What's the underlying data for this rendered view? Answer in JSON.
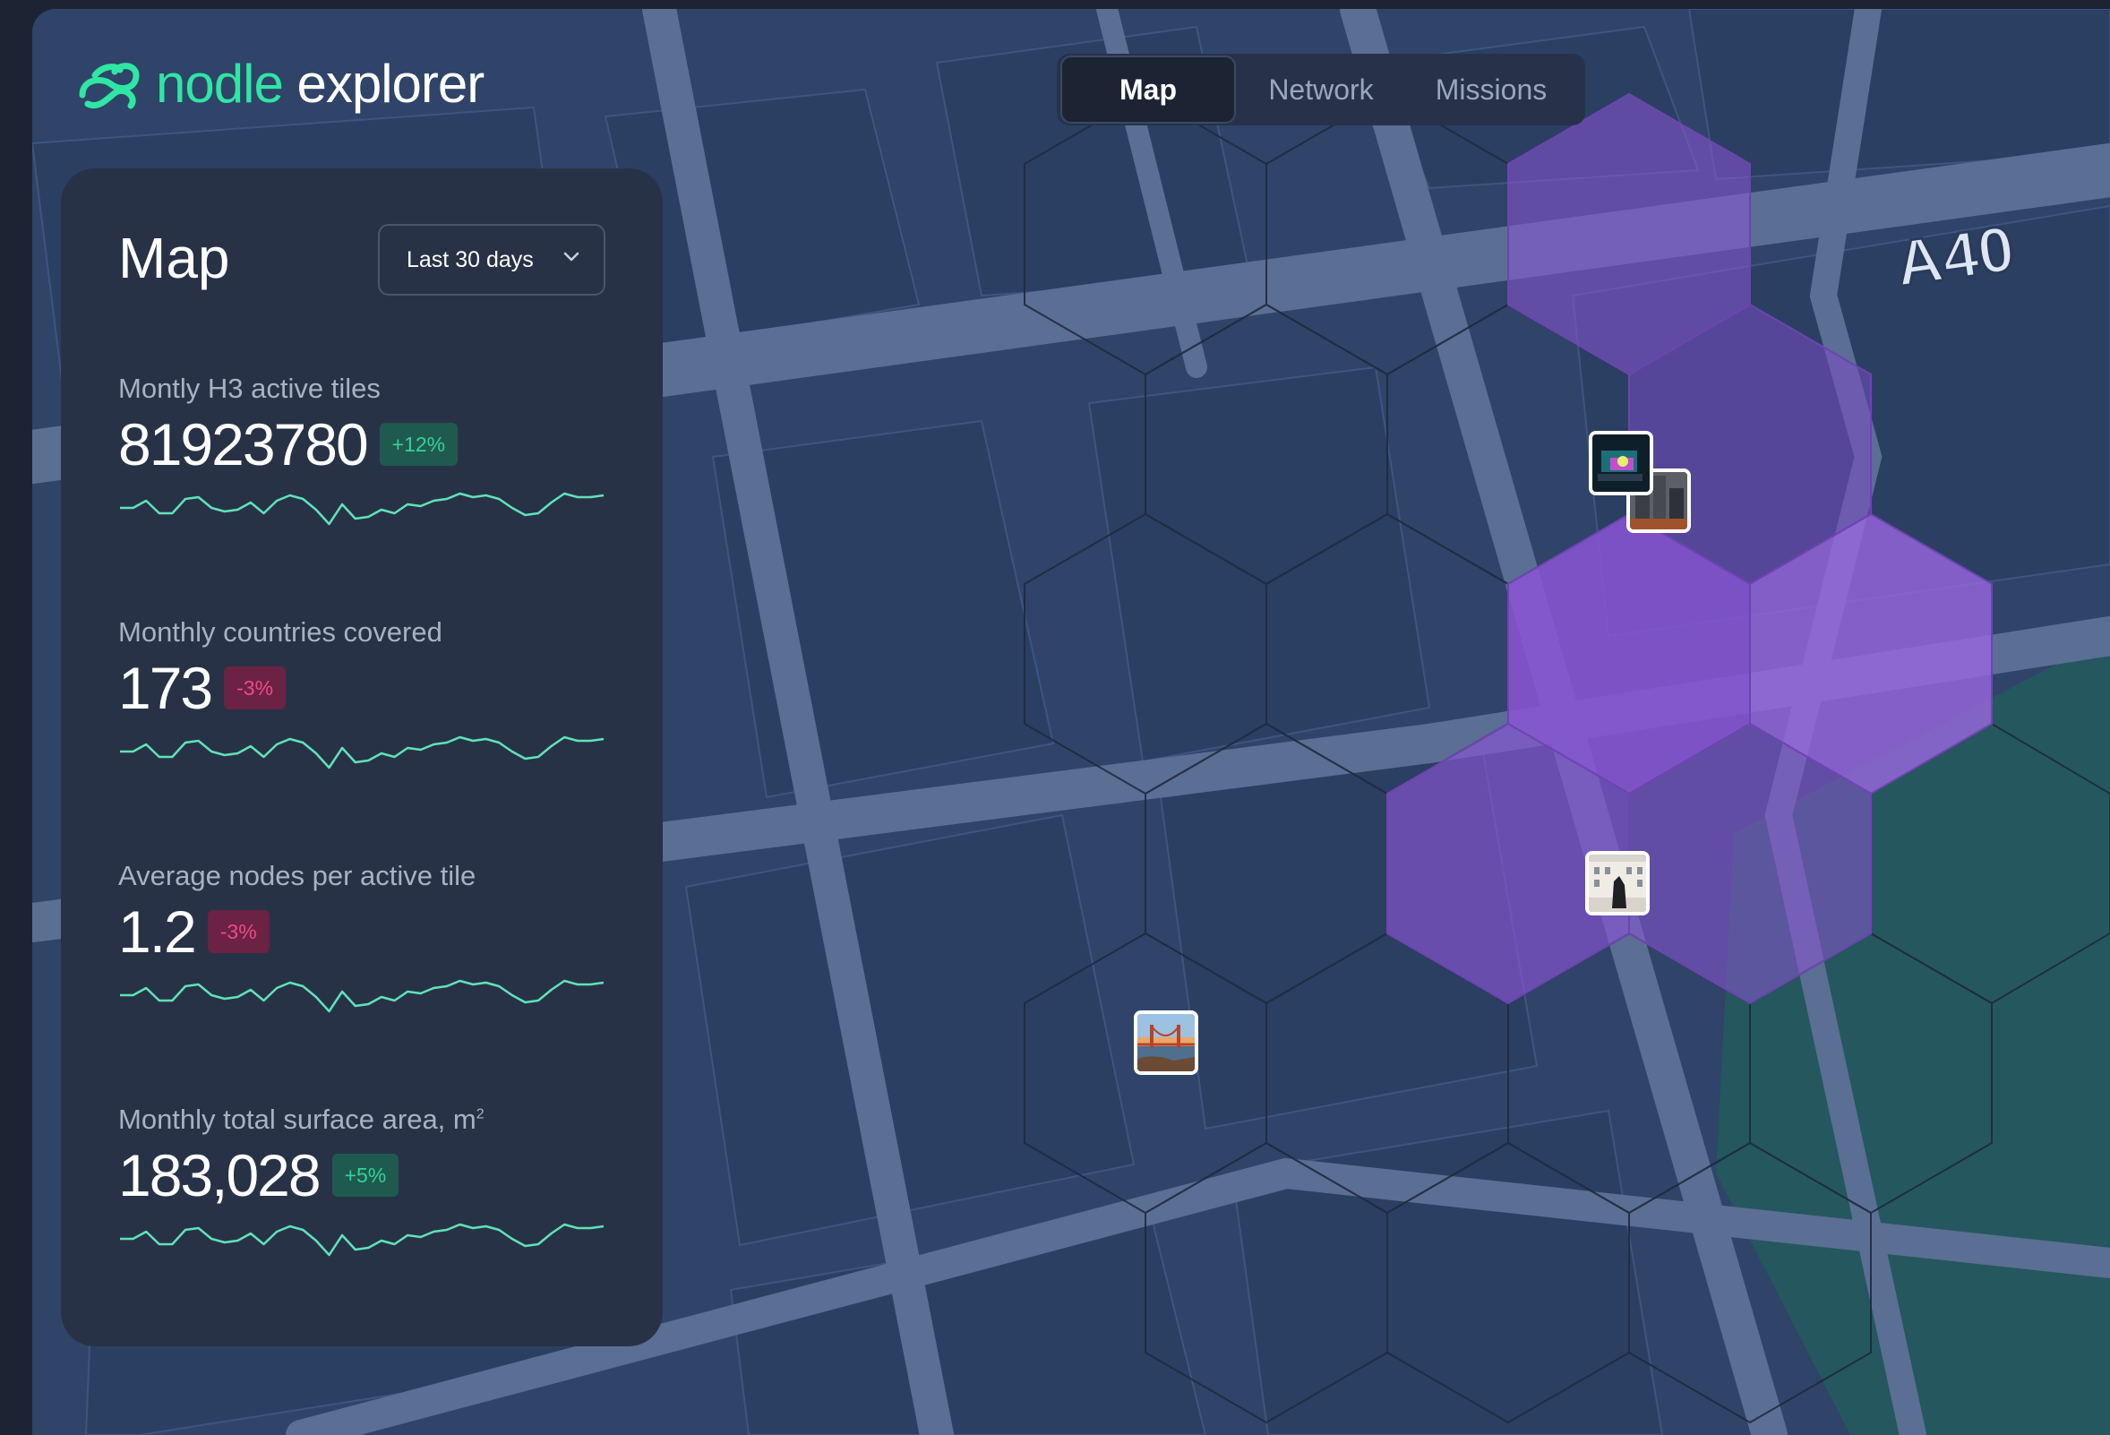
{
  "app": {
    "brand_part1": "nodle",
    "brand_part2": "explorer"
  },
  "nav": {
    "tabs": [
      {
        "label": "Map",
        "active": true
      },
      {
        "label": "Network",
        "active": false
      },
      {
        "label": "Missions",
        "active": false
      }
    ]
  },
  "panel": {
    "title": "Map",
    "range_label": "Last 30 days",
    "metrics": [
      {
        "label": "Montly H3 active tiles",
        "value": "81923780",
        "change": "+12%",
        "trend": "up"
      },
      {
        "label": "Monthly countries covered",
        "value": "173",
        "change": "-3%",
        "trend": "down"
      },
      {
        "label": "Average nodes per active tile",
        "value": "1.2",
        "change": "-3%",
        "trend": "down"
      },
      {
        "label": "Monthly total surface area, m",
        "label_sup": "2",
        "value": "183,028",
        "change": "+5%",
        "trend": "up"
      }
    ]
  },
  "map": {
    "road_label": "A40",
    "photo_markers": [
      "drone-photo",
      "city-photo",
      "building-statue-photo",
      "bridge-photo"
    ]
  },
  "colors": {
    "accent": "#2fe6a4",
    "panel_bg": "#283246",
    "map_bg": "#2f4468",
    "hex_highlight": "#8a55d6",
    "badge_up": "#32d39a",
    "badge_down": "#ef4a83"
  }
}
